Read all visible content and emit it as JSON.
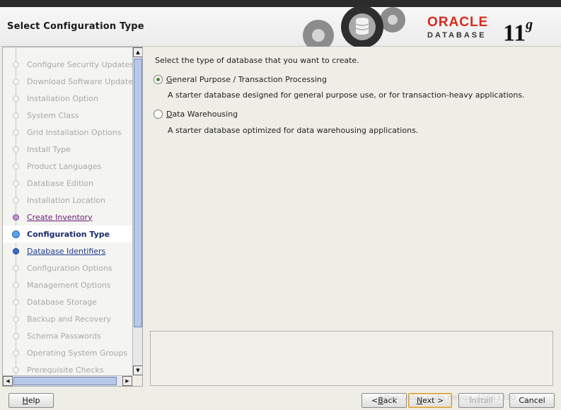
{
  "header": {
    "title": "Select Configuration Type",
    "logo_brand": "ORACLE",
    "logo_product": "DATABASE",
    "logo_version": "11",
    "logo_version_suffix": "g"
  },
  "nav": {
    "items": [
      {
        "label": "Configure Security Updates",
        "state": "pending"
      },
      {
        "label": "Download Software Updates",
        "state": "pending"
      },
      {
        "label": "Installation Option",
        "state": "pending"
      },
      {
        "label": "System Class",
        "state": "pending"
      },
      {
        "label": "Grid Installation Options",
        "state": "pending"
      },
      {
        "label": "Install Type",
        "state": "pending"
      },
      {
        "label": "Product Languages",
        "state": "pending"
      },
      {
        "label": "Database Edition",
        "state": "pending"
      },
      {
        "label": "Installation Location",
        "state": "pending"
      },
      {
        "label": "Create Inventory",
        "state": "done"
      },
      {
        "label": "Configuration Type",
        "state": "current"
      },
      {
        "label": "Database Identifiers",
        "state": "next"
      },
      {
        "label": "Configuration Options",
        "state": "pending"
      },
      {
        "label": "Management Options",
        "state": "pending"
      },
      {
        "label": "Database Storage",
        "state": "pending"
      },
      {
        "label": "Backup and Recovery",
        "state": "pending"
      },
      {
        "label": "Schema Passwords",
        "state": "pending"
      },
      {
        "label": "Operating System Groups",
        "state": "pending"
      },
      {
        "label": "Prerequisite Checks",
        "state": "pending"
      }
    ]
  },
  "main": {
    "prompt": "Select the type of database that you want to create.",
    "options": [
      {
        "mnemonic": "G",
        "label_rest": "eneral Purpose / Transaction Processing",
        "description": "A starter database designed for general purpose use, or for transaction-heavy applications.",
        "selected": true
      },
      {
        "mnemonic": "D",
        "label_rest": "ata Warehousing",
        "description": "A starter database optimized for data warehousing applications.",
        "selected": false
      }
    ]
  },
  "buttons": {
    "help": {
      "mnemonic": "H",
      "rest": "elp"
    },
    "back": {
      "prefix": "< ",
      "mnemonic": "B",
      "rest": "ack"
    },
    "next": {
      "mnemonic": "N",
      "rest": "ext >"
    },
    "install": {
      "label": "Install"
    },
    "cancel": {
      "label": "Cancel"
    }
  },
  "watermark": "https://blog.csdn.net/qq_42663310"
}
